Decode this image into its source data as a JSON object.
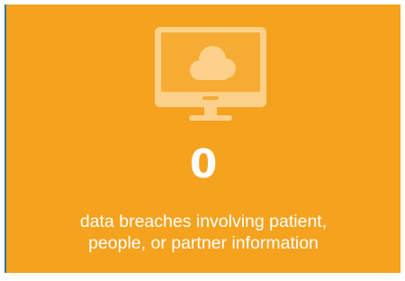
{
  "card": {
    "background_color": "#f5a21e",
    "edge_color": "#2d7a9c",
    "icon": "cloud-monitor-icon",
    "number": "0",
    "caption_line_1": "data breaches involving patient,",
    "caption_line_2": "people, or partner information"
  }
}
